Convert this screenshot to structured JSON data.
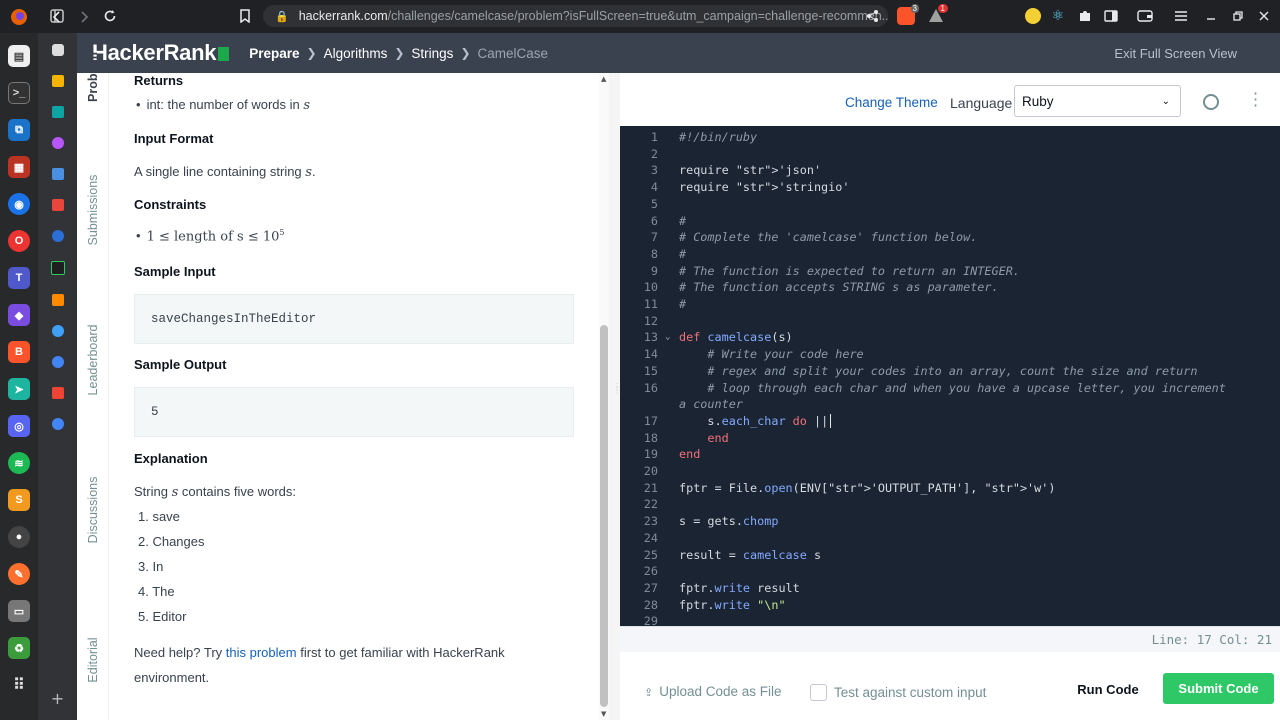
{
  "browser": {
    "url_host": "hackerrank.com",
    "url_path": "/challenges/camelcase/problem?isFullScreen=true&utm_campaign=challenge-recommen...",
    "brave_badge": "3",
    "alert_badge": "1"
  },
  "header": {
    "logo": "HackerRank",
    "breadcrumb": [
      "Prepare",
      "Algorithms",
      "Strings",
      "CamelCase"
    ],
    "exit_fullscreen": "Exit Full Screen View"
  },
  "left_tabs": [
    "Problem",
    "Submissions",
    "Leaderboard",
    "Discussions",
    "Editorial"
  ],
  "problem": {
    "returns_heading": "Returns",
    "returns_item_prefix": "int: the number of words in ",
    "returns_item_var": "s",
    "input_heading": "Input Format",
    "input_text_prefix": "A single line containing string ",
    "input_text_var": "s",
    "input_text_suffix": ".",
    "constraints_heading": "Constraints",
    "constraint_lhs": "1 ≤ length of s ≤ 10",
    "constraint_exp": "5",
    "sample_input_heading": "Sample Input",
    "sample_input": "saveChangesInTheEditor",
    "sample_output_heading": "Sample Output",
    "sample_output": "5",
    "explanation_heading": "Explanation",
    "explanation_prefix": "String ",
    "explanation_var": "s",
    "explanation_suffix": " contains five words:",
    "words": [
      "1. save",
      "2. Changes",
      "3. In",
      "4. The",
      "5. Editor"
    ],
    "help_prefix": "Need help? Try ",
    "help_link": "this problem",
    "help_suffix_1": " first to get familiar with HackerRank",
    "help_suffix_2": "environment."
  },
  "editor": {
    "change_theme": "Change Theme",
    "language_label": "Language",
    "language_value": "Ruby",
    "status": "Line: 17 Col: 21",
    "upload": "Upload Code as File",
    "custom_input": "Test against custom input",
    "run": "Run Code",
    "submit": "Submit Code"
  },
  "code_lines": [
    {
      "n": "1",
      "t": "#!/bin/ruby",
      "c": "cm"
    },
    {
      "n": "2",
      "t": "",
      "c": ""
    },
    {
      "n": "3",
      "t": "require 'json'",
      "c": ""
    },
    {
      "n": "4",
      "t": "require 'stringio'",
      "c": ""
    },
    {
      "n": "5",
      "t": "",
      "c": ""
    },
    {
      "n": "6",
      "t": "#",
      "c": "cm"
    },
    {
      "n": "7",
      "t": "# Complete the 'camelcase' function below.",
      "c": "cm"
    },
    {
      "n": "8",
      "t": "#",
      "c": "cm"
    },
    {
      "n": "9",
      "t": "# The function is expected to return an INTEGER.",
      "c": "cm"
    },
    {
      "n": "10",
      "t": "# The function accepts STRING s as parameter.",
      "c": "cm"
    },
    {
      "n": "11",
      "t": "#",
      "c": "cm"
    },
    {
      "n": "12",
      "t": "",
      "c": ""
    },
    {
      "n": "13",
      "t": "def camelcase(s)",
      "c": ""
    },
    {
      "n": "14",
      "t": "    # Write your code here",
      "c": "cm"
    },
    {
      "n": "15",
      "t": "    # regex and split your codes into an array, count the size and return",
      "c": "cm"
    },
    {
      "n": "16",
      "t": "    # loop through each char and when you have a upcase letter, you increment",
      "c": "cm"
    },
    {
      "n": "",
      "t": "a counter",
      "c": "cm"
    },
    {
      "n": "17",
      "t": "    s.each_char do ||",
      "c": ""
    },
    {
      "n": "18",
      "t": "    end",
      "c": ""
    },
    {
      "n": "19",
      "t": "end",
      "c": ""
    },
    {
      "n": "20",
      "t": "",
      "c": ""
    },
    {
      "n": "21",
      "t": "fptr = File.open(ENV['OUTPUT_PATH'], 'w')",
      "c": ""
    },
    {
      "n": "22",
      "t": "",
      "c": ""
    },
    {
      "n": "23",
      "t": "s = gets.chomp",
      "c": ""
    },
    {
      "n": "24",
      "t": "",
      "c": ""
    },
    {
      "n": "25",
      "t": "result = camelcase s",
      "c": ""
    },
    {
      "n": "26",
      "t": "",
      "c": ""
    },
    {
      "n": "27",
      "t": "fptr.write result",
      "c": ""
    },
    {
      "n": "28",
      "t": "fptr.write \"\\n\"",
      "c": ""
    },
    {
      "n": "29",
      "t": "",
      "c": ""
    }
  ]
}
